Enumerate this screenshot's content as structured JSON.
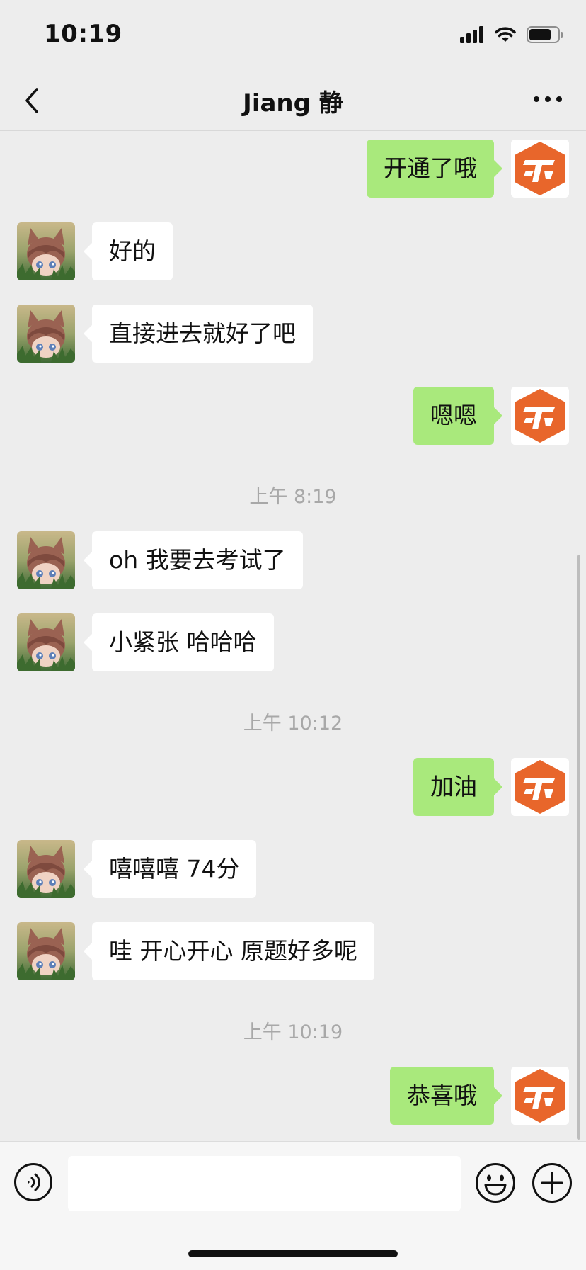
{
  "status_bar": {
    "time": "10:19",
    "icons": [
      "signal-icon",
      "wifi-icon",
      "battery-icon"
    ]
  },
  "header": {
    "title": "Jiang 静",
    "back_icon": "chevron-left-icon",
    "more_icon": "more-dots-icon"
  },
  "messages": [
    {
      "side": "out",
      "text": "开通了哦"
    },
    {
      "side": "in",
      "text": "好的"
    },
    {
      "side": "in",
      "text": "直接进去就好了吧"
    },
    {
      "side": "out",
      "text": "嗯嗯"
    },
    {
      "timestamp": "上午 8:19"
    },
    {
      "side": "in",
      "text": "oh 我要去考试了"
    },
    {
      "side": "in",
      "text": "小紧张 哈哈哈"
    },
    {
      "timestamp": "上午 10:12"
    },
    {
      "side": "out",
      "text": "加油"
    },
    {
      "side": "in",
      "text": "嘻嘻嘻 74分"
    },
    {
      "side": "in",
      "text": "哇 开心开心 原题好多呢"
    },
    {
      "timestamp": "上午 10:19"
    },
    {
      "side": "out",
      "text": "恭喜哦"
    }
  ],
  "input_bar": {
    "text_value": "",
    "voice_icon": "voice-icon",
    "emoji_icon": "emoji-icon",
    "plus_icon": "plus-icon"
  },
  "colors": {
    "background": "#ededed",
    "outgoing_bubble": "#a9e97c",
    "incoming_bubble": "#ffffff",
    "timestamp_text": "#a8a8a8",
    "sender_logo": "#e8662b"
  }
}
